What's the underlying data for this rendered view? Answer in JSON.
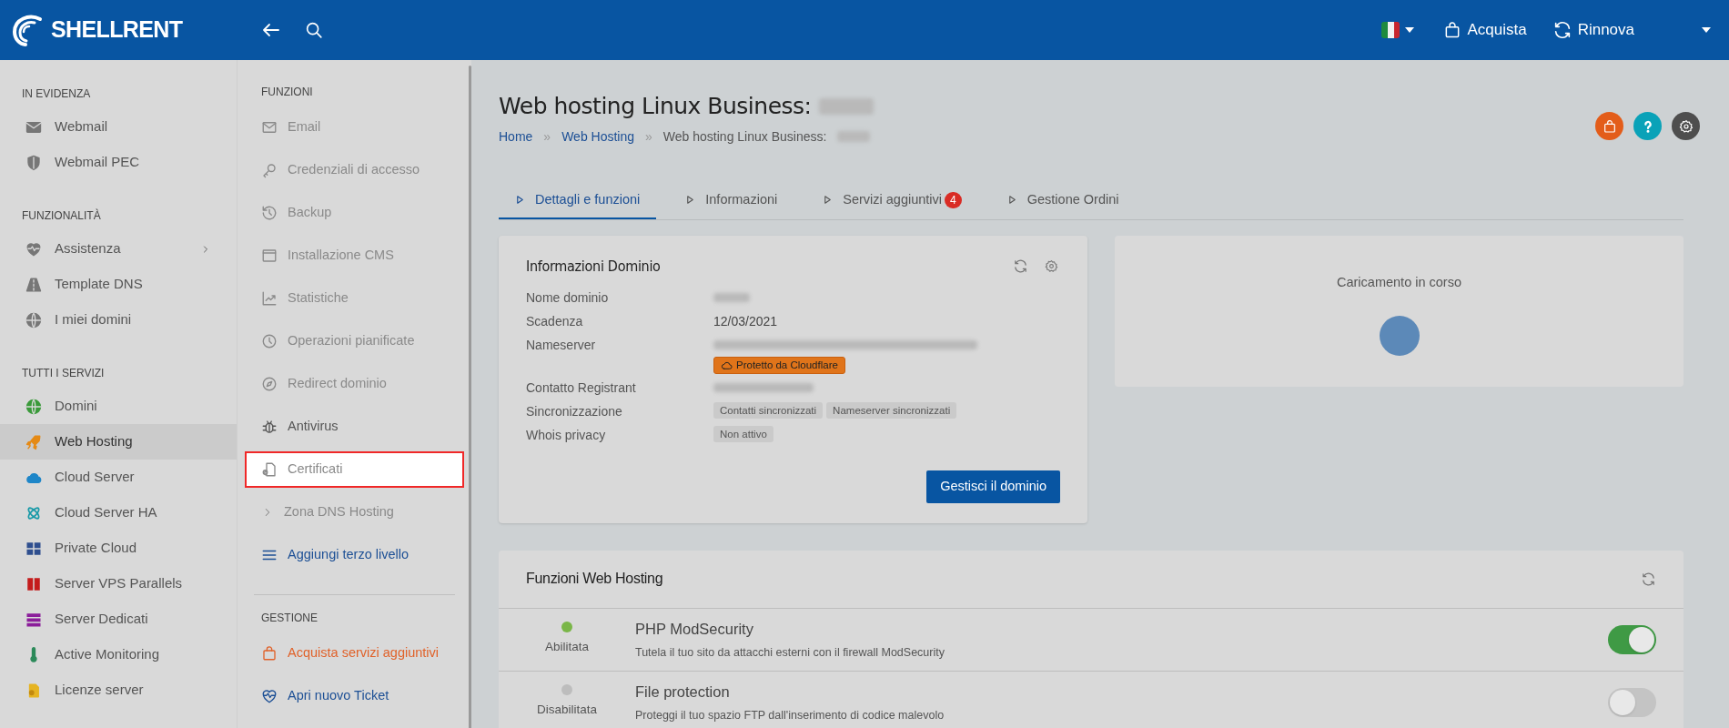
{
  "header": {
    "logo": "SHELLRENT",
    "actions": [
      {
        "kind": "language"
      },
      {
        "kind": "buy",
        "label": "Acquista"
      },
      {
        "kind": "renew",
        "label": "Rinnova"
      },
      {
        "kind": "account"
      }
    ]
  },
  "sidebar": {
    "sections": [
      {
        "title": "IN EVIDENZA",
        "items": [
          {
            "label": "Webmail",
            "selected": false,
            "expandable": false
          },
          {
            "label": "Webmail PEC",
            "selected": false,
            "expandable": false
          }
        ]
      },
      {
        "title": "FUNZIONALITÀ",
        "items": [
          {
            "label": "Assistenza",
            "selected": false,
            "expandable": true
          },
          {
            "label": "Template DNS",
            "selected": false,
            "expandable": false
          },
          {
            "label": "I miei domini",
            "selected": false,
            "expandable": false
          }
        ]
      },
      {
        "title": "TUTTI I SERVIZI",
        "items": [
          {
            "label": "Domini",
            "selected": false,
            "expandable": false
          },
          {
            "label": "Web Hosting",
            "selected": true,
            "expandable": false
          },
          {
            "label": "Cloud Server",
            "selected": false,
            "expandable": false
          },
          {
            "label": "Cloud Server HA",
            "selected": false,
            "expandable": false
          },
          {
            "label": "Private Cloud",
            "selected": false,
            "expandable": false
          },
          {
            "label": "Server VPS Parallels",
            "selected": false,
            "expandable": false
          },
          {
            "label": "Server Dedicati",
            "selected": false,
            "expandable": false
          },
          {
            "label": "Active Monitoring",
            "selected": false,
            "expandable": false
          },
          {
            "label": "Licenze server",
            "selected": false,
            "expandable": false
          }
        ]
      }
    ]
  },
  "functions_panel": {
    "sections": [
      {
        "title": "FUNZIONI",
        "items": [
          {
            "label": "Email",
            "kind": "disabled",
            "highlighted": false
          },
          {
            "label": "Credenziali di accesso",
            "kind": "disabled",
            "highlighted": false
          },
          {
            "label": "Backup",
            "kind": "disabled",
            "highlighted": false
          },
          {
            "label": "Installazione CMS",
            "kind": "disabled",
            "highlighted": false
          },
          {
            "label": "Statistiche",
            "kind": "disabled",
            "highlighted": false
          },
          {
            "label": "Operazioni pianificate",
            "kind": "disabled",
            "highlighted": false
          },
          {
            "label": "Redirect dominio",
            "kind": "disabled",
            "highlighted": false
          },
          {
            "label": "Antivirus",
            "kind": "normal",
            "highlighted": false
          },
          {
            "label": "Certificati",
            "kind": "disabled",
            "highlighted": true
          },
          {
            "label": "Zona DNS Hosting",
            "kind": "expandable",
            "highlighted": false
          },
          {
            "label": "Aggiungi terzo livello",
            "kind": "link",
            "highlighted": false
          }
        ]
      },
      {
        "title": "GESTIONE",
        "items": [
          {
            "label": "Acquista servizi aggiuntivi",
            "kind": "accent",
            "highlighted": false
          },
          {
            "label": "Apri nuovo Ticket",
            "kind": "link",
            "highlighted": false
          }
        ]
      }
    ]
  },
  "page": {
    "title": "Web hosting Linux Business:",
    "title_redacted": true,
    "breadcrumb": [
      {
        "label": "Home",
        "link": true
      },
      {
        "label": "Web Hosting",
        "link": true,
        "separator": "»"
      },
      {
        "label": "Web hosting Linux Business:",
        "link": false,
        "redacted": true,
        "separator": "»"
      }
    ],
    "tabs": [
      {
        "label": "Dettagli e funzioni",
        "selected": true
      },
      {
        "label": "Informazioni",
        "selected": false
      },
      {
        "label": "Servizi aggiuntivi",
        "selected": false,
        "badge": "4"
      },
      {
        "label": "Gestione Ordini",
        "selected": false
      }
    ]
  },
  "domain_card": {
    "title": "Informazioni Dominio",
    "rows": [
      {
        "label": "Nome dominio",
        "redacted": true
      },
      {
        "label": "Scadenza",
        "value": "12/03/2021"
      },
      {
        "label": "Nameserver",
        "redacted": true,
        "badges": [
          {
            "text": "Protetto da Cloudflare",
            "kind": "warning"
          }
        ]
      },
      {
        "label": "Contatto Registrant",
        "redacted": true
      },
      {
        "label": "Sincronizzazione",
        "badges": [
          {
            "text": "Contatti sincronizzati",
            "kind": "neutral"
          },
          {
            "text": "Nameserver sincronizzati",
            "kind": "neutral"
          }
        ]
      },
      {
        "label": "Whois privacy",
        "badges": [
          {
            "text": "Non attivo",
            "kind": "neutral"
          }
        ]
      }
    ],
    "button": "Gestisci il dominio"
  },
  "loading_card": {
    "text": "Caricamento in corso"
  },
  "features_card": {
    "title": "Funzioni Web Hosting",
    "features": [
      {
        "status": "Abilitata",
        "enabled": true,
        "name": "PHP ModSecurity",
        "description": "Tutela il tuo sito da attacchi esterni con il firewall ModSecurity"
      },
      {
        "status": "Disabilitata",
        "enabled": false,
        "name": "File protection",
        "description": "Proteggi il tuo spazio FTP dall'inserimento di codice malevolo"
      }
    ]
  }
}
